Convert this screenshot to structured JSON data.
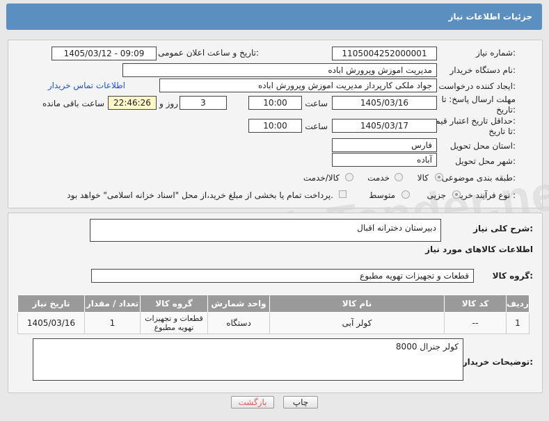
{
  "header": {
    "title": "جزئیات اطلاعات نیاز"
  },
  "form": {
    "need_number_label": "شماره نیاز:",
    "need_number": "1105004252000001",
    "announce_label": "تاریخ و ساعت اعلان عمومی:",
    "announce_value": "1405/03/12 - 09:09",
    "buyer_label": "نام دستگاه خریدار:",
    "buyer_value": "مدیریت اموزش وپرورش اباده",
    "creator_label": "ایجاد کننده درخواست:",
    "creator_value": "جواد ملکی کارپرداز مدیریت اموزش وپرورش اباده",
    "contact_link": "اطلاعات تماس خریدار",
    "deadline_label_1": "مهلت ارسال پاسخ: تا",
    "deadline_label_2": "تاریخ:",
    "deadline_date": "1405/03/16",
    "time_label": "ساعت",
    "deadline_time": "10:00",
    "days_value": "3",
    "days_label": "روز و",
    "remaining_time": "22:46:26",
    "remaining_label": "ساعت باقی مانده",
    "validity_label_1": "حداقل تاریخ اعتبار قیمت:",
    "validity_label_2": "تا تاریخ:",
    "validity_date": "1405/03/17",
    "validity_time": "10:00",
    "province_label": "استان محل تحویل:",
    "province_value": "فارس",
    "city_label": "شهر محل تحویل:",
    "city_value": "آباده",
    "category_label": "طبقه بندی موضوعی:",
    "category_options": [
      "کالا",
      "خدمت",
      "کالا/خدمت"
    ],
    "category_selected": "کالا",
    "process_label": "نوع فرآیند خرید :",
    "process_options": [
      "جزیی",
      "متوسط"
    ],
    "process_selected": "جزیی",
    "payment_note": "پرداخت تمام یا بخشی از مبلغ خرید،از محل \"اسناد خزانه اسلامی\" خواهد بود."
  },
  "summary": {
    "label": "شرح کلی نیاز:",
    "value": "دبیرستان دخترانه اقبال"
  },
  "goods": {
    "section_title": "اطلاعات کالاهای مورد نیاز",
    "group_label": "گروه کالا:",
    "group_value": "قطعات و تجهیزات تهویه مطبوع",
    "columns": [
      "ردیف",
      "کد کالا",
      "نام کالا",
      "واحد شمارش",
      "گروه کالا",
      "تعداد / مقدار",
      "تاریخ نیاز"
    ],
    "rows": [
      {
        "index": "1",
        "code": "--",
        "name": "کولر آبی",
        "unit": "دستگاه",
        "group_line1": "قطعات و تجهیزات",
        "group_line2": "تهویه مطبوع",
        "qty": "1",
        "date": "1405/03/16"
      }
    ],
    "buyer_notes_label": "توضیحات خریدار:",
    "buyer_notes_value": "کولر جنرال 8000"
  },
  "buttons": {
    "print": "چاپ",
    "back": "بازگشت"
  },
  "watermark": "AriaTender.net"
}
